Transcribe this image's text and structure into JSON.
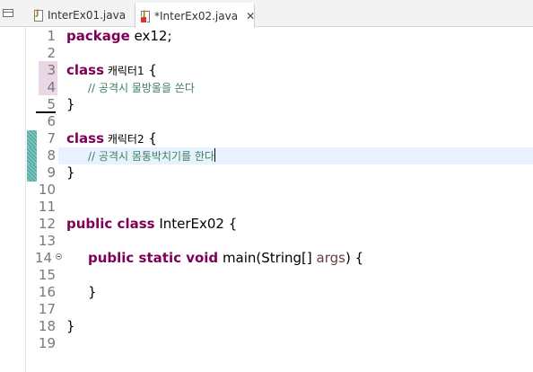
{
  "tabs": [
    {
      "label": "InterEx01.java",
      "active": false,
      "dirty": false
    },
    {
      "label": "*InterEx02.java",
      "active": true,
      "dirty": true,
      "close_glyph": "✕"
    }
  ],
  "icons": {
    "panel": "restore-panel-icon",
    "java_file": "java-file-icon",
    "java_error": "java-file-error-icon",
    "close": "close-icon",
    "collapse": "collapse-icon"
  },
  "colors": {
    "keyword": "#7f0055",
    "comment": "#3f7f5f",
    "current_line": "#e8f2fe",
    "change_marker": "#7ac9c1",
    "occurrence_marker": "#e9d7e6"
  },
  "editor": {
    "current_line": 8,
    "line_numbers": [
      "1",
      "2",
      "3",
      "4",
      "5",
      "6",
      "7",
      "8",
      "9",
      "10",
      "11",
      "12",
      "13",
      "14",
      "15",
      "16",
      "17",
      "18",
      "19"
    ],
    "code": {
      "l1_kw": "package",
      "l1_rest": " ex12;",
      "l3_kw": "class",
      "l3_name": " 캐릭터1",
      "l3_rest": " {",
      "l4_comment": "// 공격시 물방울을 쏜다",
      "l5": "}",
      "l7_kw": "class",
      "l7_name": " 캐릭터2",
      "l7_rest": " {",
      "l8_comment": "// 공격시 몸통박치기를 한다",
      "l9": "}",
      "l12_kw": "public class",
      "l12_rest": " InterEx02 {",
      "l14_kw": "public static void",
      "l14_a": " main(String[] ",
      "l14_param": "args",
      "l14_b": ") {",
      "l16": "}",
      "l18": "}"
    }
  }
}
